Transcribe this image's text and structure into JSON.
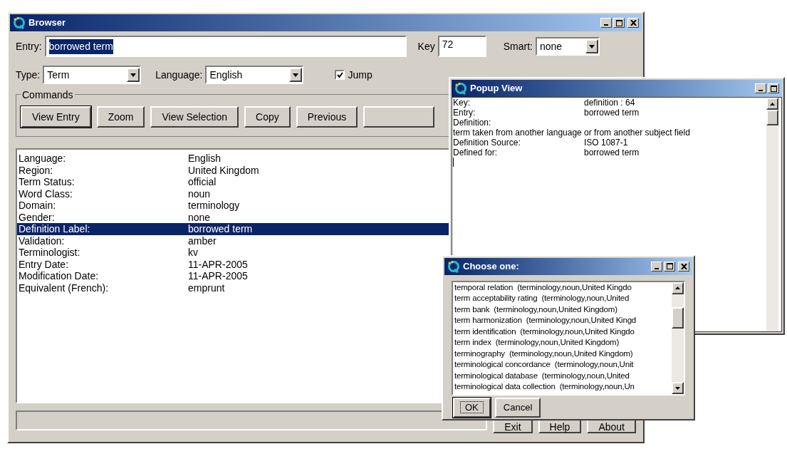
{
  "browser": {
    "title": "Browser",
    "entry": {
      "label": "Entry:",
      "value": "borrowed term",
      "selected": true
    },
    "key": {
      "label": "Key",
      "value": "72"
    },
    "smart": {
      "label": "Smart:",
      "value": "none"
    },
    "type": {
      "label": "Type:",
      "value": "Term"
    },
    "language": {
      "label": "Language:",
      "value": "English"
    },
    "jump": {
      "label": "Jump",
      "checked": true
    },
    "commands": {
      "title": "Commands",
      "buttons": [
        {
          "label": "View Entry",
          "default": true
        },
        {
          "label": "Zoom",
          "default": false
        },
        {
          "label": "View Selection",
          "default": false
        },
        {
          "label": "Copy",
          "default": false
        },
        {
          "label": "Previous",
          "default": false
        }
      ]
    },
    "fields": [
      {
        "label": "Language:",
        "value": "English",
        "selected": false
      },
      {
        "label": "Region:",
        "value": "United Kingdom",
        "selected": false
      },
      {
        "label": "Term Status:",
        "value": "official",
        "selected": false
      },
      {
        "label": "Word Class:",
        "value": "noun",
        "selected": false
      },
      {
        "label": "Domain:",
        "value": "terminology",
        "selected": false
      },
      {
        "label": "Gender:",
        "value": "none",
        "selected": false
      },
      {
        "label": "Definition Label:",
        "value": "borrowed term",
        "selected": true
      },
      {
        "label": "Validation:",
        "value": "amber",
        "selected": false
      },
      {
        "label": "Terminologist:",
        "value": "kv",
        "selected": false
      },
      {
        "label": "Entry Date:",
        "value": "11-APR-2005",
        "selected": false
      },
      {
        "label": "Modification Date:",
        "value": "11-APR-2005",
        "selected": false
      },
      {
        "label": "Equivalent (French):",
        "value": "emprunt",
        "selected": false
      }
    ],
    "bottom_buttons": [
      "Exit",
      "Help",
      "About"
    ]
  },
  "popup": {
    "title": "Popup View",
    "lines": [
      {
        "kind": "pair",
        "label": "Key:",
        "value": "definition : 64"
      },
      {
        "kind": "pair",
        "label": "Entry:",
        "value": "borrowed term"
      },
      {
        "kind": "text",
        "text": "Definition:"
      },
      {
        "kind": "text",
        "text": "term taken from another language or from another subject field"
      },
      {
        "kind": "pair",
        "label": "Definition Source:",
        "value": "ISO 1087-1"
      },
      {
        "kind": "pair",
        "label": "Defined for:",
        "value": "borrowed term"
      }
    ]
  },
  "choose": {
    "title": "Choose one:",
    "items": [
      "temporal relation  (terminology,noun,United Kingdo",
      "term acceptability rating  (terminology,noun,United",
      "term bank  (terminology,noun,United Kingdom)",
      "term harmonization  (terminology,noun,United Kingd",
      "term identification  (terminology,noun,United Kingdo",
      "term index  (terminology,noun,United Kingdom)",
      "terminography  (terminology,noun,United Kingdom)",
      "terminological concordance  (terminology,noun,Unit",
      "terminological database  (terminology,noun,United",
      "terminological data collection  (terminology,noun,Un"
    ],
    "buttons": [
      {
        "label": "OK",
        "focused": true
      },
      {
        "label": "Cancel",
        "focused": false
      }
    ]
  }
}
